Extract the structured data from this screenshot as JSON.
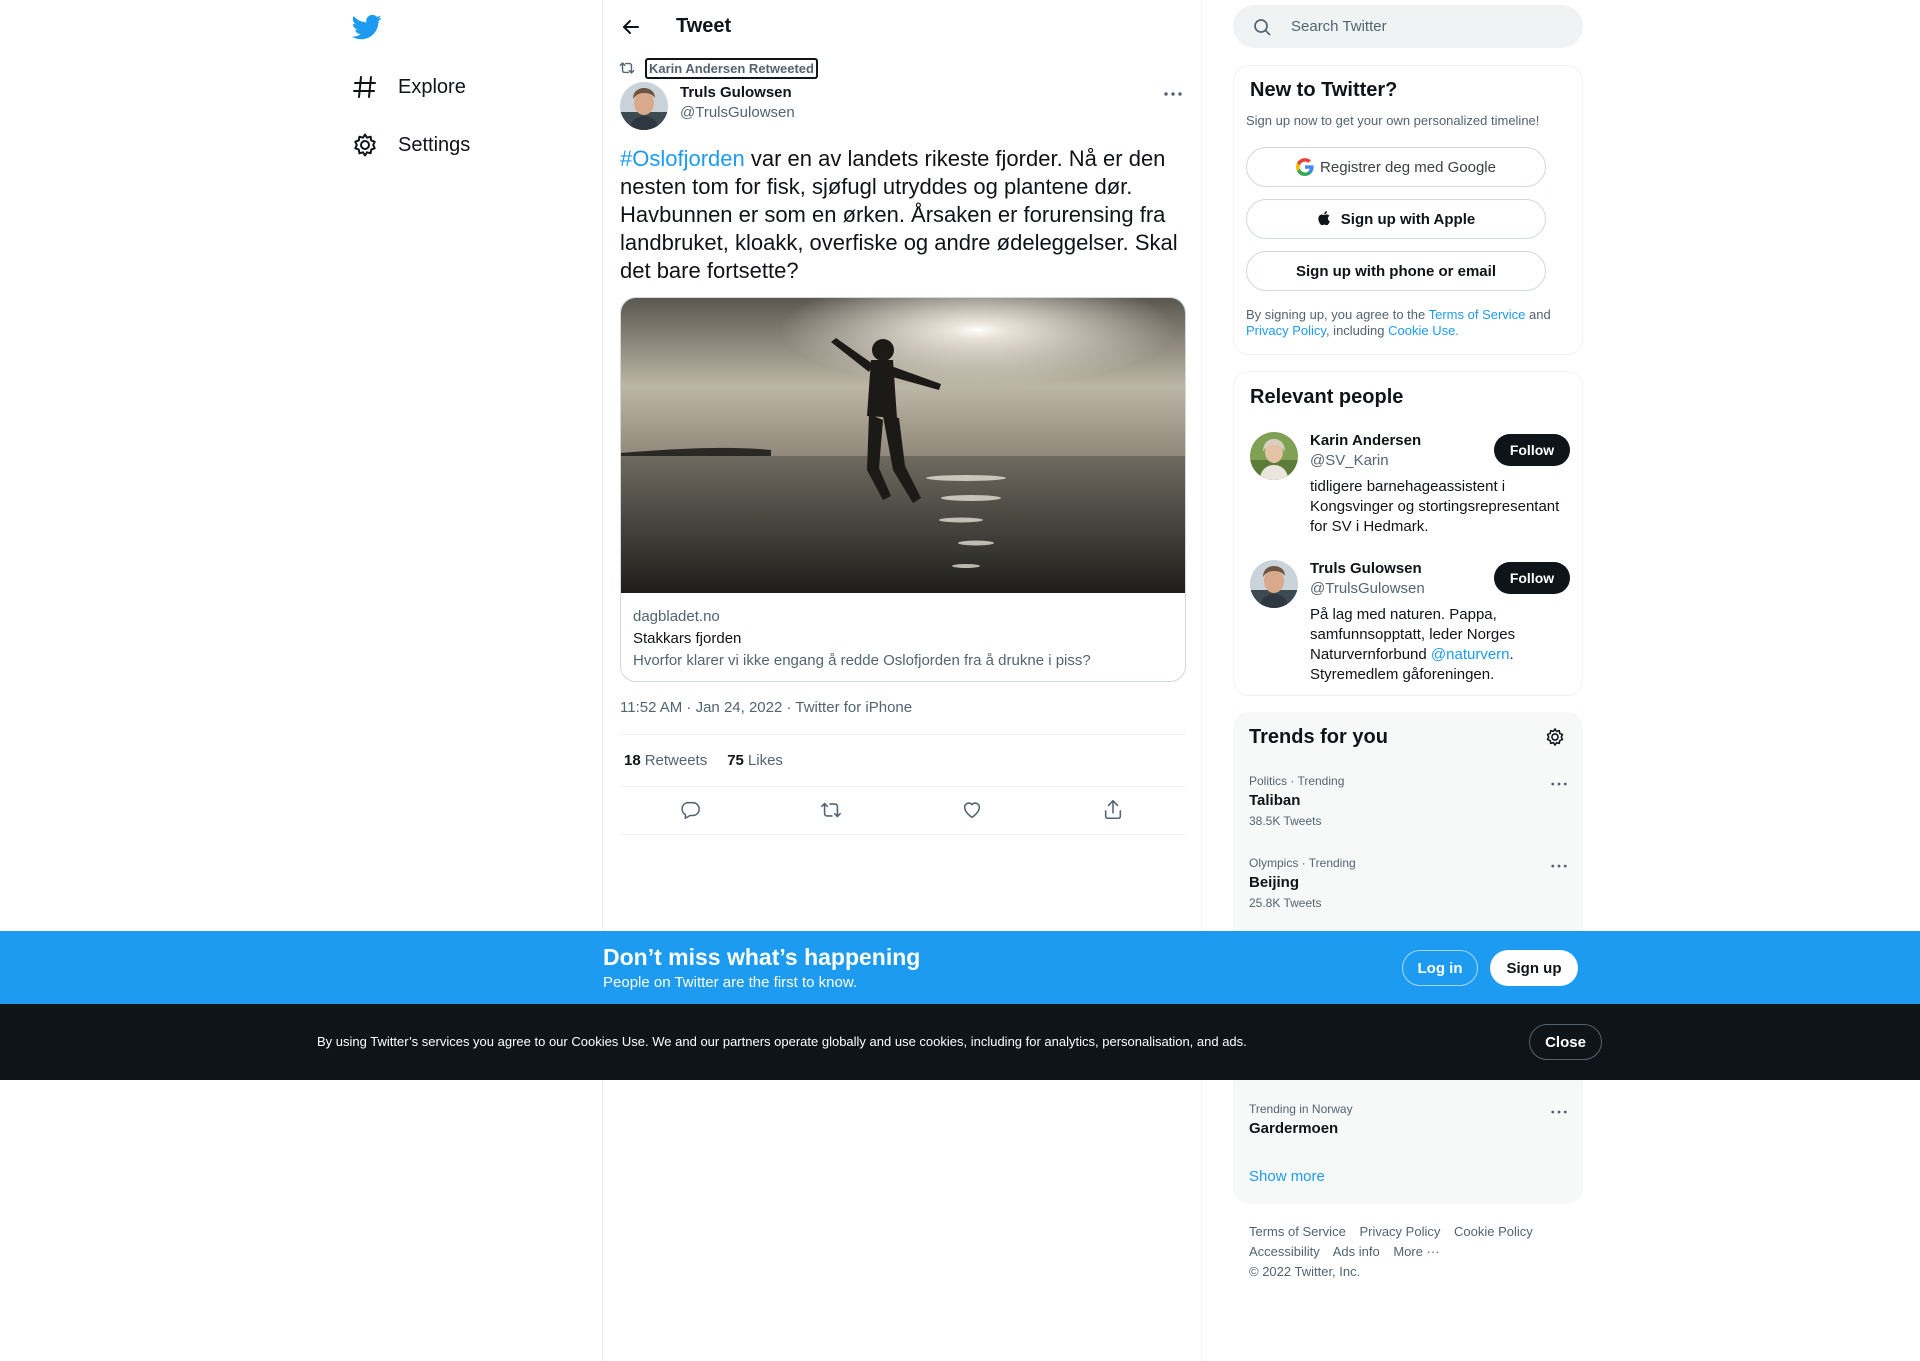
{
  "colors": {
    "accent": "#1d9bf0",
    "text": "#0f1419",
    "muted": "#536471",
    "dark": "#0f1419"
  },
  "nav": {
    "logo_icon": "twitter-bird-icon",
    "items": [
      {
        "label": "Explore",
        "icon": "hashtag-icon"
      },
      {
        "label": "Settings",
        "icon": "gear-icon"
      }
    ]
  },
  "header": {
    "title": "Tweet",
    "back_icon": "arrow-left-icon"
  },
  "tweet": {
    "retweeted_by": "Karin Andersen Retweeted",
    "author_name": "Truls Gulowsen",
    "author_handle": "@TrulsGulowsen",
    "hashtag": "#Oslofjorden",
    "text": " var en av landets rikeste fjorder. Nå er den nesten tom for fisk, sjøfugl utryddes og plantene dør. Havbunnen er som en ørken. Årsaken er forurensing fra landbruket, kloakk, overfiske og andre ødeleggelser. Skal det bare fortsette?",
    "card": {
      "domain": "dagbladet.no",
      "title": "Stakkars fjorden",
      "description": "Hvorfor klarer vi ikke engang å redde Oslofjorden fra å drukne i piss?"
    },
    "timestamp": "11:52 AM · Jan 24, 2022 · Twitter for iPhone",
    "retweets_count": "18",
    "retweets_label": "Retweets",
    "likes_count": "75",
    "likes_label": "Likes"
  },
  "search": {
    "placeholder": "Search Twitter"
  },
  "new_to_twitter": {
    "title": "New to Twitter?",
    "subtitle": "Sign up now to get your own personalized timeline!",
    "google_label": "Registrer deg med Google",
    "apple_label": "Sign up with Apple",
    "phone_label": "Sign up with phone or email",
    "legal_prefix": "By signing up, you agree to the ",
    "tos": "Terms of Service",
    "and": " and ",
    "privacy": "Privacy Policy",
    "including": ", including ",
    "cookie": "Cookie Use."
  },
  "relevant_people": {
    "title": "Relevant people",
    "follow_label": "Follow",
    "people": [
      {
        "name": "Karin Andersen",
        "handle": "@SV_Karin",
        "bio": "tidligere barnehageassistent i Kongsvinger og stortingsrepresentant for SV i Hedmark."
      },
      {
        "name": "Truls Gulowsen",
        "handle": "@TrulsGulowsen",
        "bio_pre": "På lag med naturen. Pappa, samfunnsopptatt, leder Norges Naturvernforbund ",
        "bio_mention": "@naturvern",
        "bio_post": ". Styremedlem gåforeningen."
      }
    ]
  },
  "trends": {
    "title": "Trends for you",
    "items": [
      {
        "meta": "Politics · Trending",
        "name": "Taliban",
        "count": "38.5K Tweets"
      },
      {
        "meta": "Olympics · Trending",
        "name": "Beijing",
        "count": "25.8K Tweets"
      },
      {
        "meta": "Trending in Norway",
        "name": "Gardermoen",
        "count": ""
      }
    ],
    "show_more": "Show more"
  },
  "footer": {
    "links": [
      "Terms of Service",
      "Privacy Policy",
      "Cookie Policy",
      "Accessibility",
      "Ads info",
      "More ···"
    ],
    "copyright": "© 2022 Twitter, Inc."
  },
  "banner": {
    "title": "Don’t miss what’s happening",
    "subtitle": "People on Twitter are the first to know.",
    "login_label": "Log in",
    "signup_label": "Sign up"
  },
  "cookies": {
    "text": "By using Twitter’s services you agree to our Cookies Use. We and our partners operate globally and use cookies, including for analytics, personalisation, and ads.",
    "close_label": "Close"
  }
}
